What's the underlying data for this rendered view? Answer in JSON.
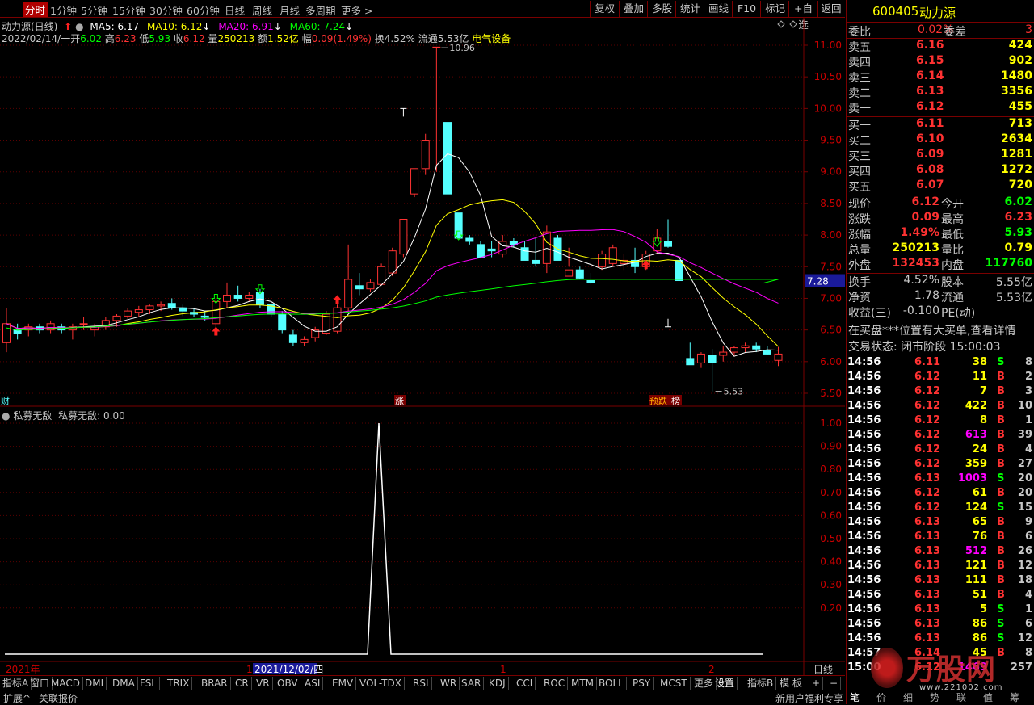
{
  "toolbar": {
    "periods": [
      "分时",
      "1分钟",
      "5分钟",
      "15分钟",
      "30分钟",
      "60分钟",
      "日线",
      "周线",
      "月线",
      "多周期",
      "更多 >"
    ],
    "active_period": "分时",
    "buttons": [
      "复权",
      "叠加",
      "多股",
      "统计",
      "画线",
      "F10",
      "标记",
      "+自选",
      "返回"
    ]
  },
  "stock": {
    "code": "600405",
    "name": "动力源"
  },
  "main_chart": {
    "title": "动力源(日线)",
    "ma5": "MA5: 6.17",
    "ma10": "MA10: 6.12",
    "ma20": "MA20: 6.91",
    "ma60": "MA60: 7.24",
    "date": "2022/02/14/一",
    "open_l": "开",
    "open": "6.02",
    "high_l": "高",
    "high": "6.23",
    "low_l": "低",
    "low": "5.93",
    "close_l": "收",
    "close": "6.12",
    "vol_l": "量",
    "vol": "250213",
    "amt_l": "额",
    "amt": "1.52亿",
    "chg_l": "幅",
    "chg": "0.09(1.49%)",
    "turnover": "换4.52%",
    "float": "流通5.53亿",
    "industry": "电气设备",
    "price_ticks": [
      "11.00",
      "10.50",
      "10.00",
      "9.50",
      "9.00",
      "8.50",
      "8.00",
      "7.50",
      "7.00",
      "6.50",
      "6.00",
      "5.50"
    ],
    "current_price_tag": "7.28",
    "max_label": "10.96",
    "min_label": "5.53",
    "markers": {
      "cai": "财",
      "zhang": "涨",
      "yudie": "预跌",
      "bang": "榜"
    }
  },
  "chart_data": [
    {
      "type": "candlestick",
      "title": "动力源(日线)",
      "y_axis": [
        5.5,
        11.0
      ],
      "ohlc": [
        [
          6.3,
          6.85,
          6.15,
          6.6
        ],
        [
          6.5,
          6.6,
          6.35,
          6.45
        ],
        [
          6.5,
          6.6,
          6.4,
          6.55
        ],
        [
          6.55,
          6.6,
          6.45,
          6.5
        ],
        [
          6.5,
          6.65,
          6.45,
          6.6
        ],
        [
          6.55,
          6.6,
          6.45,
          6.5
        ],
        [
          6.5,
          6.6,
          6.35,
          6.55
        ],
        [
          6.6,
          6.7,
          6.5,
          6.6
        ],
        [
          6.5,
          6.6,
          6.4,
          6.55
        ],
        [
          6.55,
          6.7,
          6.5,
          6.65
        ],
        [
          6.65,
          6.75,
          6.55,
          6.72
        ],
        [
          6.72,
          6.85,
          6.68,
          6.8
        ],
        [
          6.78,
          6.88,
          6.7,
          6.82
        ],
        [
          6.82,
          6.9,
          6.75,
          6.88
        ],
        [
          6.88,
          6.95,
          6.8,
          6.9
        ],
        [
          6.92,
          7.0,
          6.82,
          6.85
        ],
        [
          6.85,
          6.9,
          6.72,
          6.8
        ],
        [
          6.78,
          6.85,
          6.7,
          6.75
        ],
        [
          6.72,
          6.8,
          6.65,
          6.7
        ],
        [
          6.6,
          7.0,
          6.45,
          6.95
        ],
        [
          6.95,
          7.25,
          6.85,
          7.05
        ],
        [
          7.05,
          7.2,
          6.95,
          7.0
        ],
        [
          7.0,
          7.1,
          6.95,
          7.05
        ],
        [
          7.1,
          7.15,
          6.85,
          6.9
        ],
        [
          6.9,
          6.95,
          6.7,
          6.75
        ],
        [
          6.75,
          6.8,
          6.45,
          6.5
        ],
        [
          6.42,
          6.5,
          6.25,
          6.3
        ],
        [
          6.3,
          6.4,
          6.25,
          6.35
        ],
        [
          6.38,
          6.55,
          6.32,
          6.5
        ],
        [
          6.45,
          6.8,
          6.42,
          6.75
        ],
        [
          6.48,
          6.9,
          6.45,
          6.85
        ],
        [
          6.85,
          7.85,
          6.8,
          7.3
        ],
        [
          7.2,
          7.4,
          7.05,
          7.15
        ],
        [
          7.15,
          7.3,
          7.1,
          7.25
        ],
        [
          7.22,
          7.55,
          7.2,
          7.5
        ],
        [
          7.4,
          7.8,
          7.35,
          7.75
        ],
        [
          7.7,
          8.25,
          7.65,
          8.25
        ],
        [
          8.65,
          9.05,
          8.6,
          9.05
        ],
        [
          9.05,
          9.6,
          8.95,
          9.5
        ],
        [
          10.97,
          10.96,
          9.0,
          10.97
        ],
        [
          9.78,
          9.78,
          8.65,
          8.65
        ],
        [
          8.35,
          8.35,
          7.95,
          7.95
        ],
        [
          7.95,
          8.0,
          7.85,
          7.9
        ],
        [
          7.85,
          7.9,
          7.65,
          7.65
        ],
        [
          7.78,
          7.9,
          7.65,
          7.75
        ],
        [
          7.7,
          8.0,
          7.65,
          7.9
        ],
        [
          7.9,
          7.95,
          7.8,
          7.85
        ],
        [
          7.8,
          7.9,
          7.6,
          7.6
        ],
        [
          7.6,
          7.95,
          7.5,
          7.55
        ],
        [
          7.55,
          8.15,
          7.4,
          8.05
        ],
        [
          7.95,
          8.0,
          7.6,
          7.6
        ],
        [
          7.35,
          7.8,
          7.5,
          7.45
        ],
        [
          7.45,
          7.5,
          7.3,
          7.32
        ],
        [
          7.28,
          7.4,
          7.22,
          7.25
        ],
        [
          7.5,
          7.75,
          7.45,
          7.7
        ],
        [
          7.55,
          7.85,
          7.5,
          7.8
        ],
        [
          7.55,
          7.7,
          7.45,
          7.6
        ],
        [
          7.6,
          7.8,
          7.4,
          7.5
        ],
        [
          7.5,
          7.75,
          7.45,
          7.7
        ],
        [
          7.75,
          8.1,
          7.7,
          7.95
        ],
        [
          7.9,
          8.25,
          7.8,
          7.82
        ],
        [
          7.6,
          7.6,
          7.28,
          7.28
        ],
        [
          6.05,
          6.3,
          5.95,
          5.95
        ],
        [
          5.98,
          6.15,
          5.9,
          6.12
        ],
        [
          6.1,
          6.2,
          5.53,
          5.98
        ],
        [
          6.1,
          6.25,
          6.0,
          6.15
        ],
        [
          6.15,
          6.25,
          6.08,
          6.22
        ],
        [
          6.22,
          6.3,
          6.15,
          6.25
        ],
        [
          6.25,
          6.3,
          6.15,
          6.2
        ],
        [
          6.18,
          6.25,
          6.1,
          6.12
        ],
        [
          6.02,
          6.23,
          5.93,
          6.12
        ]
      ],
      "ma5": "6.17",
      "ma10": "6.12",
      "ma20": "6.91",
      "ma60": "7.24"
    },
    {
      "type": "line",
      "title": "私募无敌",
      "series": [
        {
          "name": "私募无敌",
          "value_label": "私募无敌: 0.00"
        }
      ],
      "y_axis": [
        0,
        1.0
      ],
      "ticks": [
        "1.00",
        "0.90",
        "0.80",
        "0.70",
        "0.60",
        "0.50",
        "0.40",
        "0.30",
        "0.20"
      ]
    }
  ],
  "sub_chart": {
    "title": "私募无敌",
    "series_label": "私募无敌: 0.00",
    "ticks": [
      "1.00",
      "0.90",
      "0.80",
      "0.70",
      "0.60",
      "0.50",
      "0.40",
      "0.30",
      "0.20"
    ]
  },
  "time_axis": {
    "labels": [
      "2021年",
      "1",
      "2021/12/02/四",
      "1",
      "2"
    ],
    "period": "日线"
  },
  "indicator_tabs": [
    "指标A",
    "窗口",
    "MACD",
    "DMI",
    "DMA",
    "FSL",
    "TRIX",
    "BRAR",
    "CR",
    "VR",
    "OBV",
    "ASI",
    "EMV",
    "VOL-TDX",
    "RSI",
    "WR",
    "SAR",
    "KDJ",
    "CCI",
    "ROC",
    "MTM",
    "BOLL",
    "PSY",
    "MCST",
    "更多",
    "设置"
  ],
  "indicator_b": "指标B",
  "template": "模 板",
  "plus": "+",
  "minus": "−",
  "status": {
    "expand": "扩展^",
    "related": "关联报价",
    "promo": "新用户福利专享"
  },
  "quote": {
    "weibi_l": "委比",
    "weibi": "0.02%",
    "weicha_l": "委差",
    "weicha": "3",
    "sell": [
      {
        "l": "卖五",
        "p": "6.16",
        "v": "424"
      },
      {
        "l": "卖四",
        "p": "6.15",
        "v": "902"
      },
      {
        "l": "卖三",
        "p": "6.14",
        "v": "1480"
      },
      {
        "l": "卖二",
        "p": "6.13",
        "v": "3356"
      },
      {
        "l": "卖一",
        "p": "6.12",
        "v": "455"
      }
    ],
    "buy": [
      {
        "l": "买一",
        "p": "6.11",
        "v": "713"
      },
      {
        "l": "买二",
        "p": "6.10",
        "v": "2634"
      },
      {
        "l": "买三",
        "p": "6.09",
        "v": "1281"
      },
      {
        "l": "买四",
        "p": "6.08",
        "v": "1272"
      },
      {
        "l": "买五",
        "p": "6.07",
        "v": "720"
      }
    ],
    "stats": [
      {
        "l1": "现价",
        "v1": "6.12",
        "l2": "今开",
        "v2": "6.02"
      },
      {
        "l1": "涨跌",
        "v1": "0.09",
        "l2": "最高",
        "v2": "6.23"
      },
      {
        "l1": "涨幅",
        "v1": "1.49%",
        "l2": "最低",
        "v2": "5.93"
      },
      {
        "l1": "总量",
        "v1": "250213",
        "l2": "量比",
        "v2": "0.79"
      },
      {
        "l1": "外盘",
        "v1": "132453",
        "l2": "内盘",
        "v2": "117760"
      }
    ],
    "stats2": [
      {
        "l1": "换手",
        "v1": "4.52%",
        "l2": "股本",
        "v2": "5.55亿"
      },
      {
        "l1": "净资",
        "v1": "1.78",
        "l2": "流通",
        "v2": "5.53亿"
      },
      {
        "l1": "收益(三)",
        "v1": "-0.100",
        "l2": "PE(动)",
        "v2": ""
      }
    ],
    "notice": "在买盘***位置有大买单,查看详情",
    "trade_state": "交易状态: 闭市阶段 15:00:03"
  },
  "ticks": [
    [
      "14:56",
      "6.11",
      "38",
      "S",
      "8"
    ],
    [
      "14:56",
      "6.12",
      "11",
      "B",
      "2"
    ],
    [
      "14:56",
      "6.12",
      "7",
      "B",
      "3"
    ],
    [
      "14:56",
      "6.12",
      "422",
      "B",
      "10"
    ],
    [
      "14:56",
      "6.12",
      "8",
      "B",
      "1"
    ],
    [
      "14:56",
      "6.12",
      "613",
      "B",
      "39"
    ],
    [
      "14:56",
      "6.12",
      "24",
      "B",
      "4"
    ],
    [
      "14:56",
      "6.12",
      "359",
      "B",
      "27"
    ],
    [
      "14:56",
      "6.13",
      "1003",
      "S",
      "20"
    ],
    [
      "14:56",
      "6.12",
      "61",
      "B",
      "20"
    ],
    [
      "14:56",
      "6.12",
      "124",
      "S",
      "15"
    ],
    [
      "14:56",
      "6.13",
      "65",
      "B",
      "9"
    ],
    [
      "14:56",
      "6.13",
      "76",
      "B",
      "6"
    ],
    [
      "14:56",
      "6.13",
      "512",
      "B",
      "26"
    ],
    [
      "14:56",
      "6.13",
      "121",
      "B",
      "12"
    ],
    [
      "14:56",
      "6.13",
      "111",
      "B",
      "18"
    ],
    [
      "14:56",
      "6.13",
      "51",
      "B",
      "4"
    ],
    [
      "14:56",
      "6.13",
      "5",
      "S",
      "1"
    ],
    [
      "14:56",
      "6.13",
      "86",
      "S",
      "6"
    ],
    [
      "14:56",
      "6.13",
      "86",
      "S",
      "12"
    ],
    [
      "14:57",
      "6.14",
      "45",
      "B",
      "8"
    ],
    [
      "15:00",
      "6.12",
      "1469",
      "",
      "257"
    ]
  ],
  "colors": {
    "up": "#ff3232",
    "down": "#54ffff",
    "ma5": "#ffffff",
    "ma10": "#ffff00",
    "ma20": "#ff00ff",
    "ma60": "#00ff00",
    "grid": "#7a0000"
  },
  "watermark": {
    "brand": "万股网",
    "url": "www.221002.com"
  },
  "tabs_bottom": [
    "笔",
    "价",
    "细",
    "势",
    "联",
    "值",
    "筹"
  ]
}
